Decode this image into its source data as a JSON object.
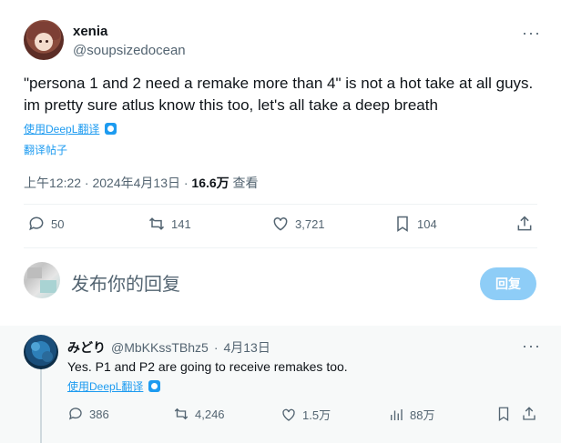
{
  "tweet": {
    "author_name": "xenia",
    "author_handle": "@soupsizedocean",
    "more": "···",
    "text_line1": "\"persona 1 and 2 need a remake more than 4\" is not a hot take at all guys.",
    "text_line2": "im pretty sure atlus know this too, let's all take a deep breath",
    "translate_deepl": "使用DeepL翻译",
    "translate_post": "翻译帖子",
    "time": "上午12:22 · 2024年4月13日 · ",
    "views_count": "16.6万",
    "views_label": " 查看",
    "actions": {
      "replies": "50",
      "retweets": "141",
      "likes": "3,721",
      "bookmarks": "104"
    },
    "icons": [
      "reply-icon",
      "retweet-icon",
      "like-icon",
      "bookmark-icon",
      "share-icon"
    ]
  },
  "composer": {
    "placeholder": "发布你的回复",
    "button": "回复",
    "button_color": "#8ecdf7"
  },
  "reply": {
    "author_name": "みどり",
    "author_handle": "@MbKKssTBhz5",
    "sep": "·",
    "date": "4月13日",
    "more": "···",
    "text": "Yes. P1 and P2 are going to receive remakes too.",
    "translate_deepl": "使用DeepL翻译",
    "actions": {
      "replies": "386",
      "retweets": "4,246",
      "likes": "1.5万",
      "views": "88万"
    }
  },
  "colors": {
    "accent": "#1d9bf0",
    "text": "#0f1419",
    "secondary": "#536471"
  }
}
